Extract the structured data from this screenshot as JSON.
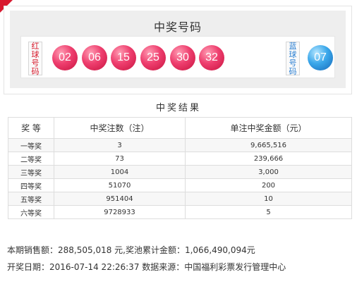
{
  "draw": {
    "title": "中奖号码",
    "red_label": [
      "红",
      "球",
      "号",
      "码"
    ],
    "blue_label": [
      "蓝",
      "球",
      "号",
      "码"
    ],
    "red_balls": [
      "02",
      "06",
      "15",
      "25",
      "30",
      "32"
    ],
    "blue_ball": "07"
  },
  "results": {
    "title": "中奖结果",
    "headers": [
      "奖 等",
      "中奖注数（注）",
      "单注中奖金额（元）"
    ],
    "rows": [
      [
        "一等奖",
        "3",
        "9,665,516"
      ],
      [
        "二等奖",
        "73",
        "239,666"
      ],
      [
        "三等奖",
        "1004",
        "3,000"
      ],
      [
        "四等奖",
        "51070",
        "200"
      ],
      [
        "五等奖",
        "951404",
        "10"
      ],
      [
        "六等奖",
        "9728933",
        "5"
      ]
    ]
  },
  "footer": {
    "sales_line": "本期销售额：288,505,018 元,奖池累计金额：1,066,490,094元",
    "date_line": "开奖日期：2016-07-14 22:26:37 数据来源：中国福利彩票发行管理中心"
  },
  "colors": {
    "accent_red": "#d8192f",
    "red_ball": "#e8336a",
    "blue_ball": "#2f98e0"
  }
}
